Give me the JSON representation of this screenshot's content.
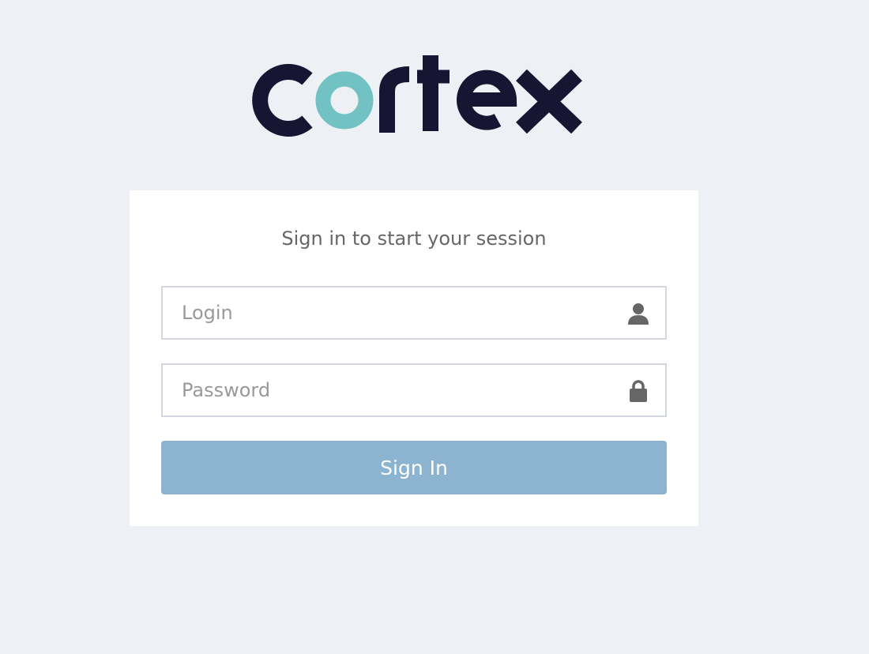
{
  "brand": {
    "logo_text": "Cortex",
    "logo_dark_color": "#161632",
    "logo_accent_color": "#72c2c4"
  },
  "login": {
    "message": "Sign in to start your session",
    "login_placeholder": "Login",
    "password_placeholder": "Password",
    "login_icon": "user-icon",
    "password_icon": "lock-icon",
    "submit_label": "Sign In",
    "submit_color": "#8cb3d0"
  }
}
